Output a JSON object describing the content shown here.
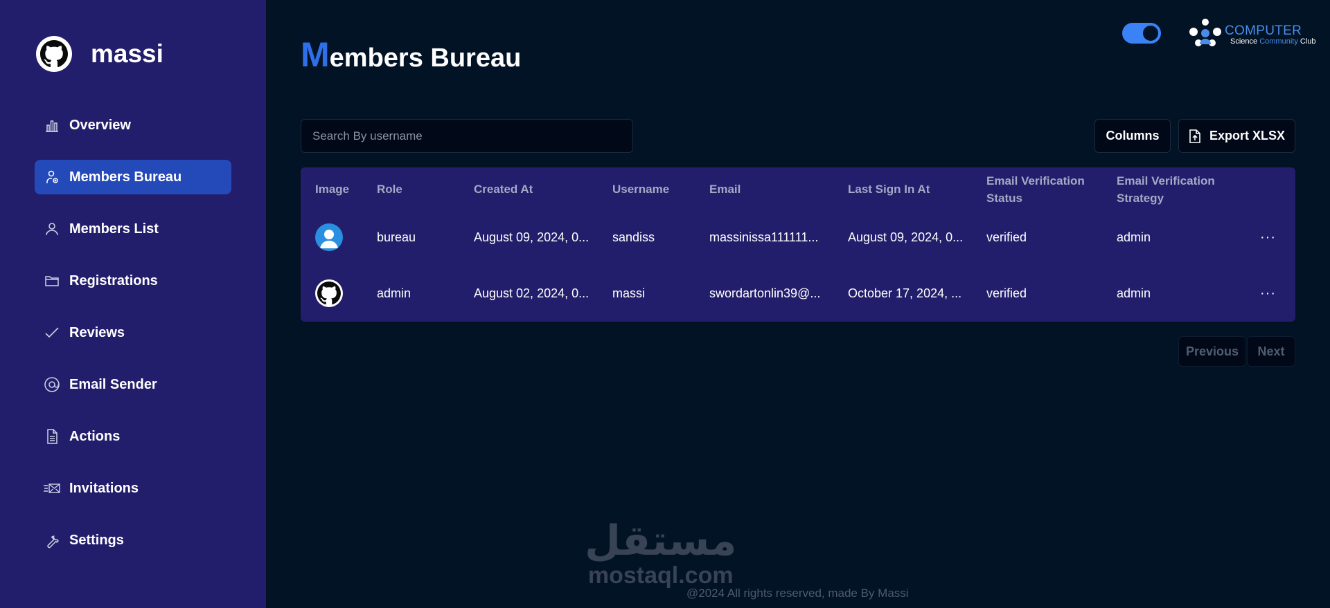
{
  "brand": {
    "name": "massi",
    "logo_icon": "github-icon"
  },
  "sidebar": {
    "items": [
      {
        "label": "Overview",
        "icon": "bar-chart-icon",
        "active": false
      },
      {
        "label": "Members Bureau",
        "icon": "user-badge-icon",
        "active": true
      },
      {
        "label": "Members List",
        "icon": "user-icon",
        "active": false
      },
      {
        "label": "Registrations",
        "icon": "folder-icon",
        "active": false
      },
      {
        "label": "Reviews",
        "icon": "check-icon",
        "active": false
      },
      {
        "label": "Email Sender",
        "icon": "at-sign-icon",
        "active": false
      },
      {
        "label": "Actions",
        "icon": "document-icon",
        "active": false
      },
      {
        "label": "Invitations",
        "icon": "mail-fast-icon",
        "active": false
      },
      {
        "label": "Settings",
        "icon": "wrench-icon",
        "active": false
      }
    ]
  },
  "header": {
    "title_first_letter": "M",
    "title_rest": "embers Bureau",
    "theme_toggle_on": true,
    "club_logo": {
      "title": "COMPUTER",
      "sub_1": "Science",
      "sub_2": "Community",
      "sub_3": "Club"
    }
  },
  "toolbar": {
    "search_placeholder": "Search By username",
    "columns_label": "Columns",
    "export_label": "Export XLSX"
  },
  "table": {
    "headers": [
      "Image",
      "Role",
      "Created At",
      "Username",
      "Email",
      "Last Sign In At",
      "Email Verification Status",
      "Email Verification Strategy"
    ],
    "rows": [
      {
        "avatar": "default-user-avatar",
        "role": "bureau",
        "created_at": "August 09, 2024, 0...",
        "username": "sandiss",
        "email": "massinissa111111...",
        "last_sign_in": "August 09, 2024, 0...",
        "verification_status": "verified",
        "verification_strategy": "admin",
        "actions": "···"
      },
      {
        "avatar": "github-avatar",
        "role": "admin",
        "created_at": "August 02, 2024, 0...",
        "username": "massi",
        "email": "swordartonlin39@...",
        "last_sign_in": "October 17, 2024, ...",
        "verification_status": "verified",
        "verification_strategy": "admin",
        "actions": "···"
      }
    ]
  },
  "pagination": {
    "previous_label": "Previous",
    "next_label": "Next"
  },
  "footer": {
    "text": "@2024 All rights reserved, made By Massi"
  },
  "watermark": {
    "arabic": "مستقل",
    "latin": "mostaql.com"
  },
  "colors": {
    "sidebar": "#231e6b",
    "background": "#021325",
    "accent": "#2449b8",
    "title_accent": "#2f6fe8"
  }
}
